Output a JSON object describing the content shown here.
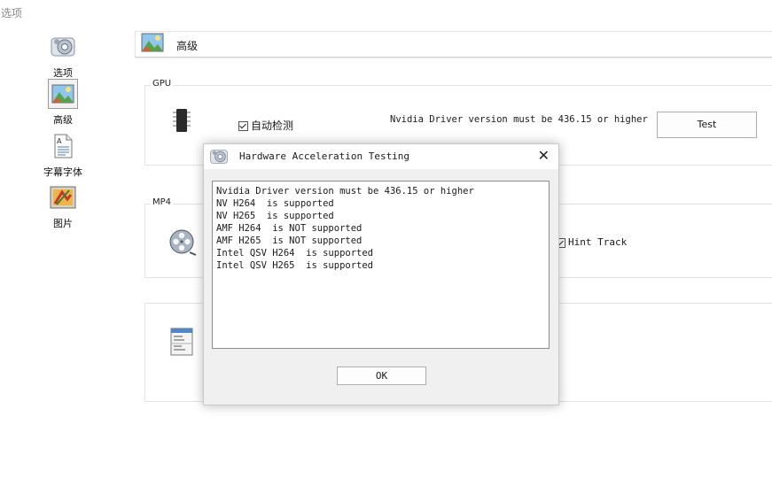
{
  "window": {
    "title": "选项"
  },
  "sidebar": {
    "items": [
      {
        "label": "选项",
        "icon": "options-gear-icon"
      },
      {
        "label": "高级",
        "icon": "landscape-picture-icon",
        "active": true
      },
      {
        "label": "字幕字体",
        "icon": "document-font-icon"
      },
      {
        "label": "图片",
        "icon": "paint-picture-icon"
      }
    ]
  },
  "header": {
    "title": "高级",
    "icon": "landscape-picture-icon"
  },
  "gpu_group": {
    "legend": "GPU",
    "checkbox_label": "自动检测",
    "checked": true,
    "driver_note": "Nvidia Driver version must be 436.15 or higher",
    "test_button": "Test"
  },
  "mp4_group": {
    "legend": "MP4",
    "hint_track_label": "Hint Track"
  },
  "dialog": {
    "title": "Hardware Acceleration Testing",
    "close_glyph": "✕",
    "lines": [
      "Nvidia Driver version must be 436.15 or higher",
      "NV H264  is supported",
      "NV H265  is supported",
      "AMF H264  is NOT supported",
      "AMF H265  is NOT supported",
      "Intel QSV H264  is supported",
      "Intel QSV H265  is supported"
    ],
    "ok_button": "OK"
  }
}
